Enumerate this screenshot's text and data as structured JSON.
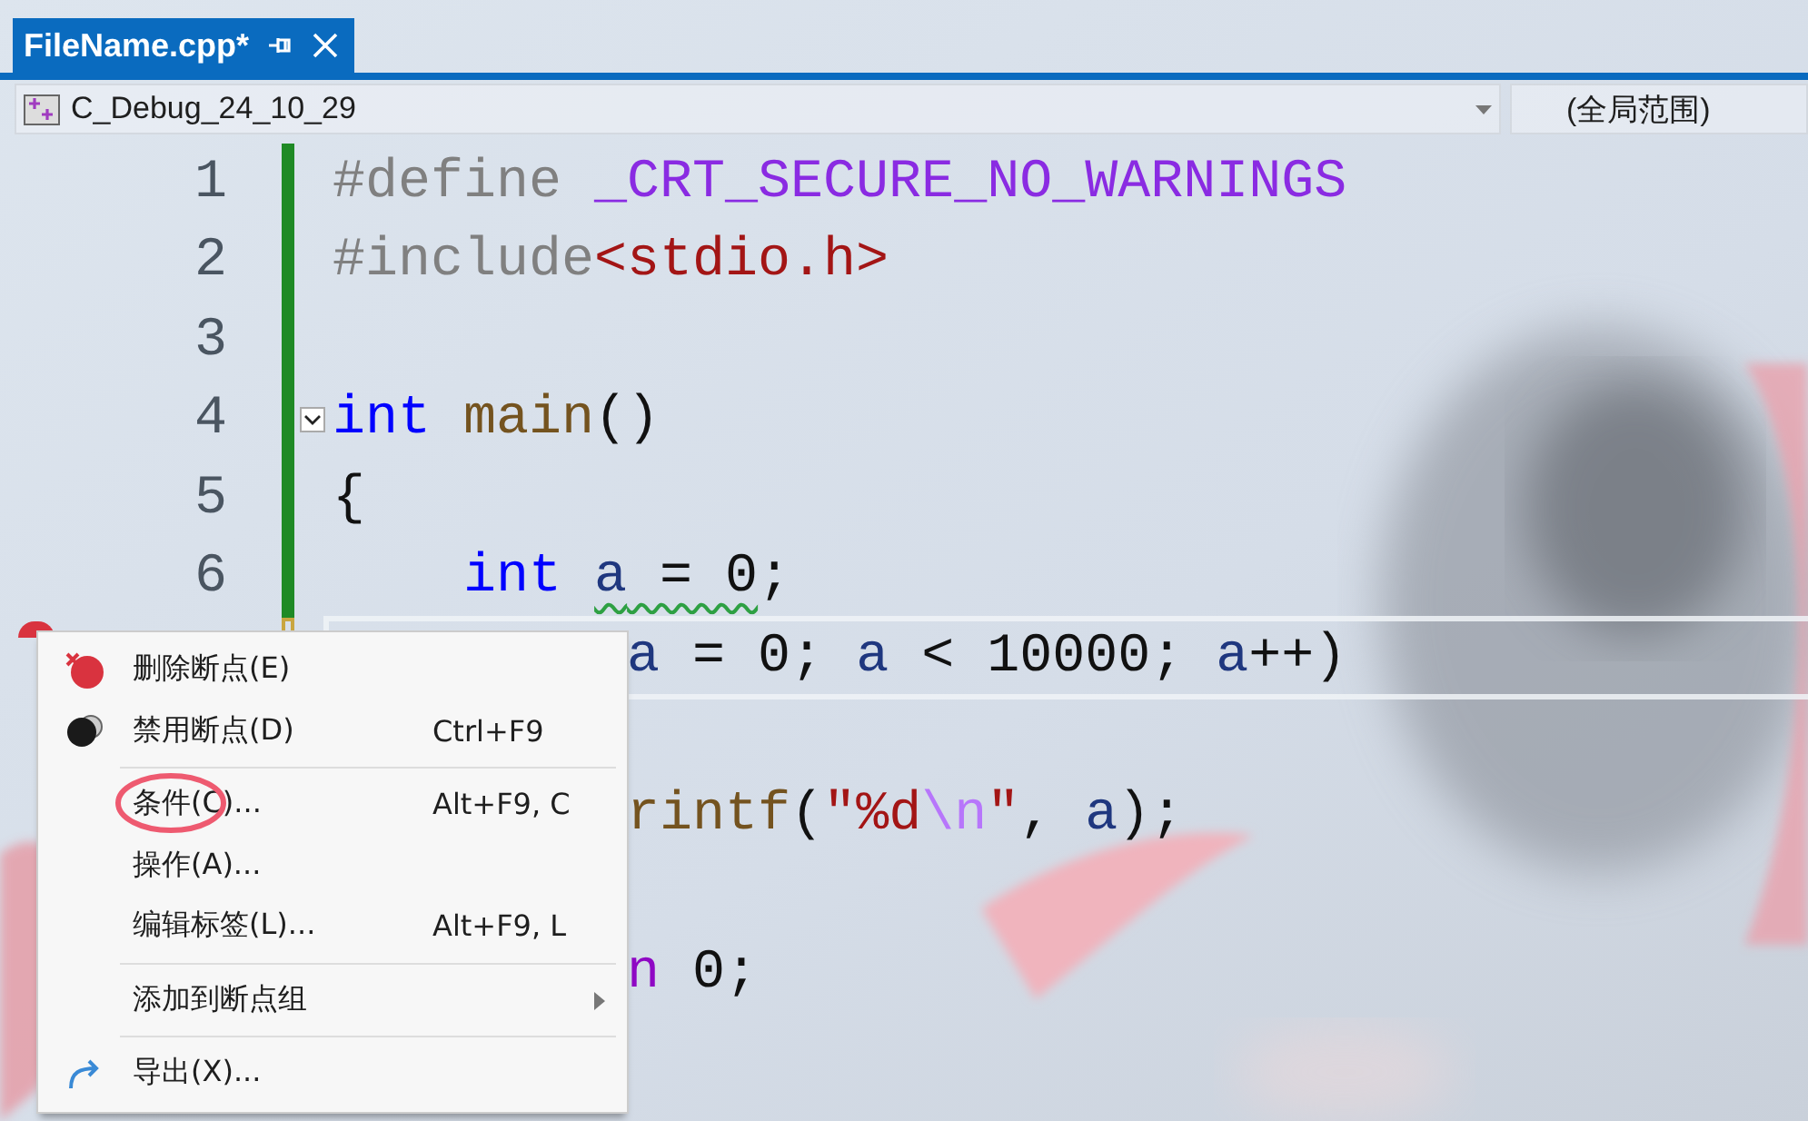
{
  "tabs": [
    {
      "label": "FileName.cpp*",
      "selected": true
    }
  ],
  "navigation": {
    "project": "C_Debug_24_10_29",
    "scope": "(全局范围)"
  },
  "lines": [
    {
      "number": "1",
      "saved": true,
      "tokens": [
        {
          "kind": "preproc",
          "text": "#define "
        },
        {
          "kind": "macro",
          "text": "_CRT_SECURE_NO_WARNINGS"
        }
      ]
    },
    {
      "number": "2",
      "saved": true,
      "tokens": [
        {
          "kind": "preproc",
          "text": "#include"
        },
        {
          "kind": "string",
          "text": "<stdio.h>"
        }
      ]
    },
    {
      "number": "3",
      "saved": true
    },
    {
      "number": "4",
      "saved": true,
      "expanded": true,
      "tokens": [
        {
          "kind": "keyword",
          "text": "int "
        },
        {
          "kind": "function",
          "text": "main"
        },
        {
          "kind": "plain",
          "text": "()"
        }
      ]
    },
    {
      "number": "5",
      "saved": true,
      "tokens": [
        {
          "kind": "plain",
          "text": "{"
        }
      ]
    },
    {
      "number": "6",
      "saved": true,
      "tokens": [
        {
          "kind": "keyword",
          "text": "    int "
        },
        {
          "kind": "ident",
          "text": "a",
          "warning": true
        },
        {
          "kind": "plain",
          "text": " = 0",
          "warning": true
        },
        {
          "kind": "plain",
          "text": ";"
        }
      ]
    },
    {
      "saved": false,
      "breakpoint": true,
      "current": true,
      "tokens": [
        {
          "kind": "ident",
          "text": "         a"
        },
        {
          "kind": "plain",
          "text": " = 0; "
        },
        {
          "kind": "ident",
          "text": "a"
        },
        {
          "kind": "plain",
          "text": " < 10000; "
        },
        {
          "kind": "ident",
          "text": "a"
        },
        {
          "kind": "plain",
          "text": "++)"
        }
      ]
    },
    {
      "tokens": [
        {
          "kind": "function",
          "text": "         rintf"
        },
        {
          "kind": "plain",
          "text": "("
        },
        {
          "kind": "string",
          "text": "\"%d"
        },
        {
          "kind": "escape",
          "text": "\\n"
        },
        {
          "kind": "string",
          "text": "\""
        },
        {
          "kind": "plain",
          "text": ", "
        },
        {
          "kind": "ident",
          "text": "a"
        },
        {
          "kind": "plain",
          "text": ");"
        }
      ]
    },
    {
      "tokens": [
        {
          "kind": "control",
          "text": "         n"
        },
        {
          "kind": "plain",
          "text": " 0;"
        }
      ]
    }
  ],
  "context_menu": [
    {
      "kind": "remove",
      "label": "删除断点(E)"
    },
    {
      "kind": "disable",
      "label": "禁用断点(D)",
      "shortcut": "Ctrl+F9"
    },
    {
      "kind": "separator"
    },
    {
      "kind": "item",
      "label": "条件(C)...",
      "shortcut": "Alt+F9, C",
      "circled": true
    },
    {
      "kind": "item",
      "label": "操作(A)..."
    },
    {
      "kind": "item",
      "label": "编辑标签(L)...",
      "shortcut": "Alt+F9, L"
    },
    {
      "kind": "separator"
    },
    {
      "kind": "item",
      "label": "添加到断点组",
      "submenu": true
    },
    {
      "kind": "separator"
    },
    {
      "kind": "export",
      "label": "导出(X)..."
    }
  ]
}
